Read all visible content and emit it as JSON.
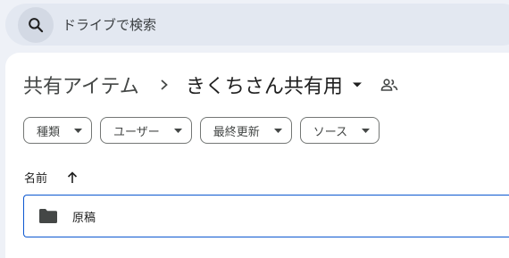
{
  "search": {
    "placeholder": "ドライブで検索",
    "icon": "search-icon"
  },
  "breadcrumb": {
    "parent": "共有アイテム",
    "current": "きくちさん共有用",
    "separator_icon": "chevron-right-icon",
    "dropdown_icon": "arrow-drop-down-icon",
    "shared_icon": "people-icon"
  },
  "filters": [
    {
      "label": "種類"
    },
    {
      "label": "ユーザー"
    },
    {
      "label": "最終更新"
    },
    {
      "label": "ソース"
    }
  ],
  "sort": {
    "column_label": "名前",
    "direction_icon": "arrow-upward-icon"
  },
  "files": [
    {
      "name": "原稿",
      "icon": "folder-icon"
    }
  ],
  "colors": {
    "background": "#eef1f7",
    "search_bar": "#e3e8f1",
    "accent_border": "#0b57d0",
    "text": "#1f1f1f"
  }
}
